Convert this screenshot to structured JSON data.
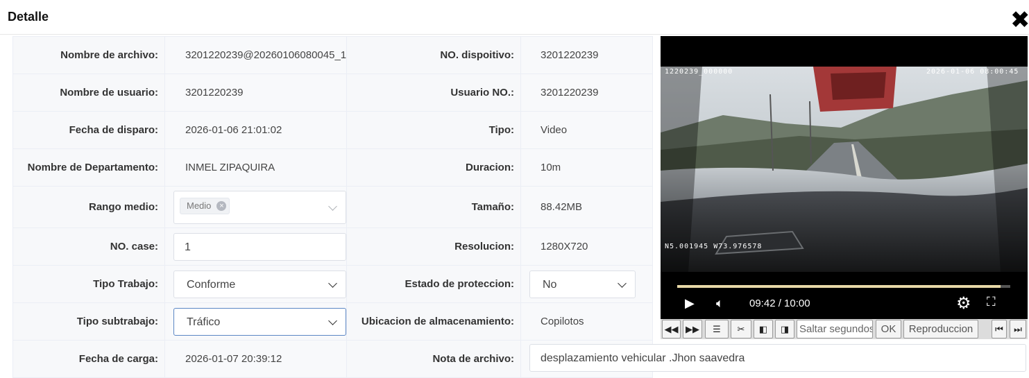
{
  "dialog": {
    "title": "Detalle",
    "close_icon": "close-icon"
  },
  "fields": {
    "file_name": {
      "label": "Nombre de archivo:",
      "value": "3201220239@20260106080045_1"
    },
    "device_no": {
      "label": "NO. dispoitivo:",
      "value": "3201220239"
    },
    "user_name": {
      "label": "Nombre de usuario:",
      "value": "3201220239"
    },
    "user_no": {
      "label": "Usuario NO.:",
      "value": "3201220239"
    },
    "trigger_date": {
      "label": "Fecha de disparo:",
      "value": "2026-01-06 21:01:02"
    },
    "type": {
      "label": "Tipo:",
      "value": "Video"
    },
    "department": {
      "label": "Nombre de Departamento:",
      "value": "INMEL ZIPAQUIRA"
    },
    "duration": {
      "label": "Duracion:",
      "value": "10m"
    },
    "range": {
      "label": "Rango medio:",
      "tag": "Medio"
    },
    "size": {
      "label": "Tamaño:",
      "value": "88.42MB"
    },
    "case_no": {
      "label": "NO. case:",
      "value": "1"
    },
    "resolution": {
      "label": "Resolucion:",
      "value": "1280X720"
    },
    "work_type": {
      "label": "Tipo Trabajo:",
      "selected": "Conforme"
    },
    "protection": {
      "label": "Estado de proteccion:",
      "selected": "No"
    },
    "work_subtype": {
      "label": "Tipo subtrabajo:",
      "selected": "Tráfico"
    },
    "storage": {
      "label": "Ubicacion de almacenamiento:",
      "value": "Copilotos"
    },
    "upload_date": {
      "label": "Fecha de carga:",
      "value": "2026-01-07 20:39:12"
    },
    "note": {
      "label": "Nota de archivo:",
      "value": "desplazamiento vehicular .Jhon saavedra"
    }
  },
  "player": {
    "overlay_top_left": "1220239_000000",
    "overlay_top_right": "2026-01-06 08:00:45",
    "overlay_gps": "N5.001945 W73.976578",
    "time": "09:42 / 10:00",
    "progress": 0.97
  },
  "toolbar": {
    "seek_placeholder": "Saltar segundos",
    "ok_label": "OK",
    "playback_label": "Reproduccion"
  }
}
